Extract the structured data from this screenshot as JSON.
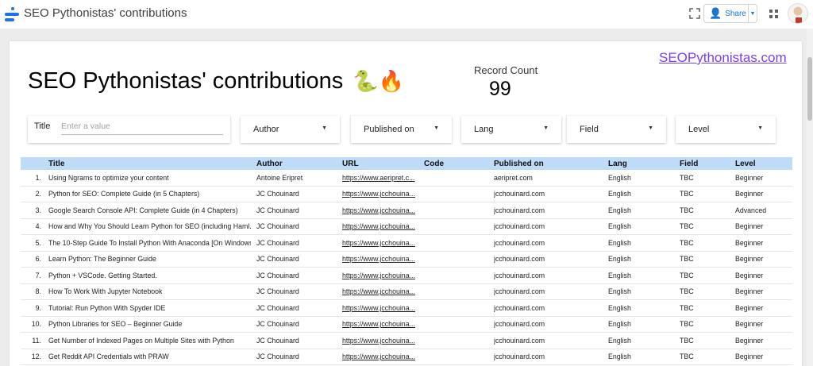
{
  "app": {
    "title": "SEO Pythonistas' contributions",
    "share_label": "Share",
    "icons": [
      "looker-studio-logo",
      "fullscreen-icon",
      "share-icon",
      "chevron-down-icon",
      "apps-grid-icon",
      "avatar"
    ],
    "accent_color": "#1a73e8"
  },
  "report": {
    "title": "SEO Pythonistas' contributions",
    "title_emoji": "🐍🔥",
    "site_link": "SEOPythonistas.com",
    "kpi": {
      "label": "Record Count",
      "value": "99"
    }
  },
  "filters": {
    "title": {
      "label": "Title",
      "placeholder": "Enter a value"
    },
    "author": "Author",
    "published_on": "Published on",
    "lang": "Lang",
    "field": "Field",
    "level": "Level"
  },
  "table": {
    "header_color": "#bedcf8",
    "columns": [
      "Title",
      "Author",
      "URL",
      "Code",
      "Published on",
      "Lang",
      "Field",
      "Level"
    ],
    "rows": [
      {
        "num": "1.",
        "title": "Using Ngrams to optimize your content",
        "author": "Antoine Eripret",
        "url": "https://www.aeripret.c...",
        "code": "",
        "published_on": "aeripret.com",
        "lang": "English",
        "field": "TBC",
        "level": "Beginner"
      },
      {
        "num": "2.",
        "title": "Python for SEO: Complete Guide (in 5 Chapters)",
        "author": "JC Chouinard",
        "url": "https://www.jcchouina...",
        "code": "",
        "published_on": "jcchouinard.com",
        "lang": "English",
        "field": "TBC",
        "level": "Beginner"
      },
      {
        "num": "3.",
        "title": "Google Search Console API: Complete Guide (in 4 Chapters)",
        "author": "JC Chouinard",
        "url": "https://www.jcchouina...",
        "code": "",
        "published_on": "jcchouinard.com",
        "lang": "English",
        "field": "TBC",
        "level": "Advanced"
      },
      {
        "num": "4.",
        "title": "How and Why You Should Learn Python for SEO (including Haml...",
        "author": "JC Chouinard",
        "url": "https://www.jcchouina...",
        "code": "",
        "published_on": "jcchouinard.com",
        "lang": "English",
        "field": "TBC",
        "level": "Beginner"
      },
      {
        "num": "5.",
        "title": "The 10-Step Guide To Install Python With Anaconda [On Windows]",
        "author": "JC Chouinard",
        "url": "https://www.jcchouina...",
        "code": "",
        "published_on": "jcchouinard.com",
        "lang": "English",
        "field": "TBC",
        "level": "Beginner"
      },
      {
        "num": "6.",
        "title": "Learn Python: The Beginner Guide",
        "author": "JC Chouinard",
        "url": "https://www.jcchouina...",
        "code": "",
        "published_on": "jcchouinard.com",
        "lang": "English",
        "field": "TBC",
        "level": "Beginner"
      },
      {
        "num": "7.",
        "title": "Python + VSCode. Getting Started.",
        "author": "JC Chouinard",
        "url": "https://www.jcchouina...",
        "code": "",
        "published_on": "jcchouinard.com",
        "lang": "English",
        "field": "TBC",
        "level": "Beginner"
      },
      {
        "num": "8.",
        "title": "How To Work With Jupyter Notebook",
        "author": "JC Chouinard",
        "url": "https://www.jcchouina...",
        "code": "",
        "published_on": "jcchouinard.com",
        "lang": "English",
        "field": "TBC",
        "level": "Beginner"
      },
      {
        "num": "9.",
        "title": "Tutorial: Run Python With Spyder IDE",
        "author": "JC Chouinard",
        "url": "https://www.jcchouina...",
        "code": "",
        "published_on": "jcchouinard.com",
        "lang": "English",
        "field": "TBC",
        "level": "Beginner"
      },
      {
        "num": "10.",
        "title": "Python Libraries for SEO – Beginner Guide",
        "author": "JC Chouinard",
        "url": "https://www.jcchouina...",
        "code": "",
        "published_on": "jcchouinard.com",
        "lang": "English",
        "field": "TBC",
        "level": "Beginner"
      },
      {
        "num": "11.",
        "title": "Get Number of Indexed Pages on Multiple Sites with Python",
        "author": "JC Chouinard",
        "url": "https://www.jcchouina...",
        "code": "",
        "published_on": "jcchouinard.com",
        "lang": "English",
        "field": "TBC",
        "level": "Beginner"
      },
      {
        "num": "12.",
        "title": "Get Reddit API Credentials with PRAW",
        "author": "JC Chouinard",
        "url": "https://www.jcchouina...",
        "code": "",
        "published_on": "jcchouinard.com",
        "lang": "English",
        "field": "TBC",
        "level": "Beginner"
      }
    ]
  }
}
